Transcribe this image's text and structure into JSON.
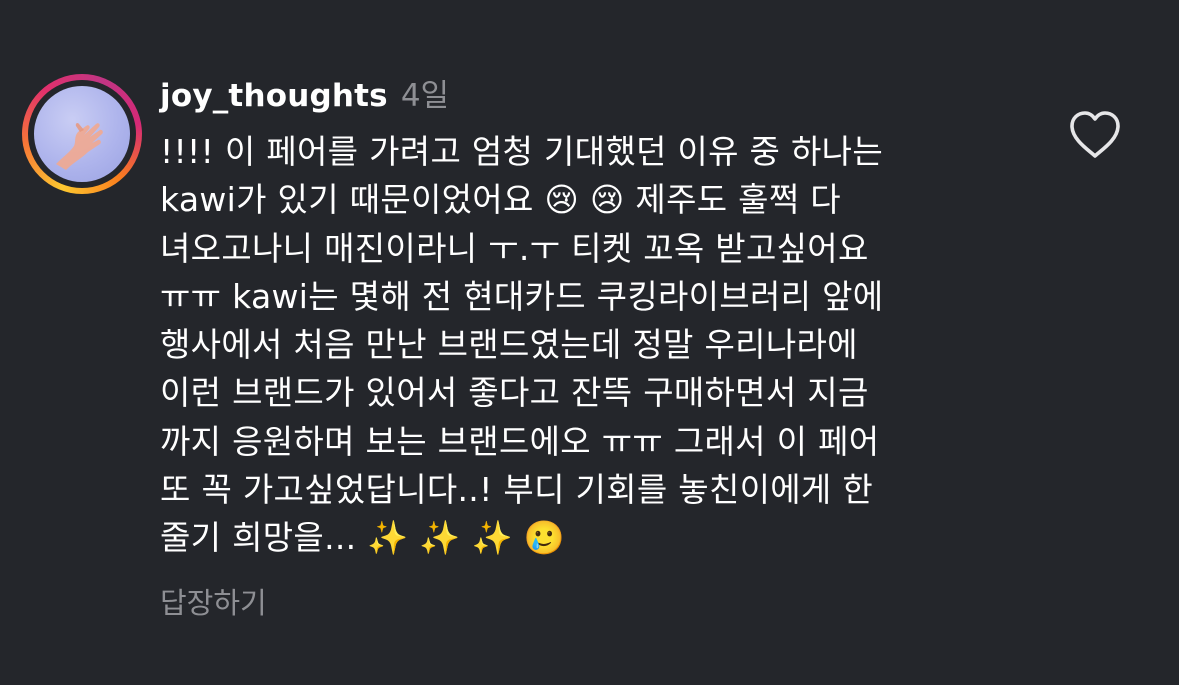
{
  "comment": {
    "username": "joy_thoughts",
    "timestamp": "4일",
    "text": "!!!! 이 페어를 가려고 엄청 기대했던 이유 중 하나는\nkawi가 있기 때문이었어요 😢 😢 제주도 훌쩍 다\n녀오고나니 매진이라니 ㅜ.ㅜ 티켓 꼬옥 받고싶어요\nㅠㅠ kawi는 몇해 전 현대카드 쿠킹라이브러리 앞에\n행사에서 처음 만난 브랜드였는데 정말 우리나라에\n이런 브랜드가 있어서 좋다고 잔뜩 구매하면서 지금\n까지 응원하며 보는 브랜드에오 ㅠㅠ 그래서 이 페어\n또 꼭 가고싶었답니다..! 부디 기회를 놓친이에게 한\n줄기 희망을... ✨ ✨ ✨ 🥲",
    "reply_label": "답장하기"
  },
  "icons": {
    "like": "heart-outline-icon",
    "avatar": "avatar-hand-photo"
  },
  "colors": {
    "background": "#24262b",
    "text": "#ffffff",
    "secondary_text": "#8e8f94",
    "story_ring_start": "#fdc830",
    "story_ring_end": "#c13584"
  }
}
